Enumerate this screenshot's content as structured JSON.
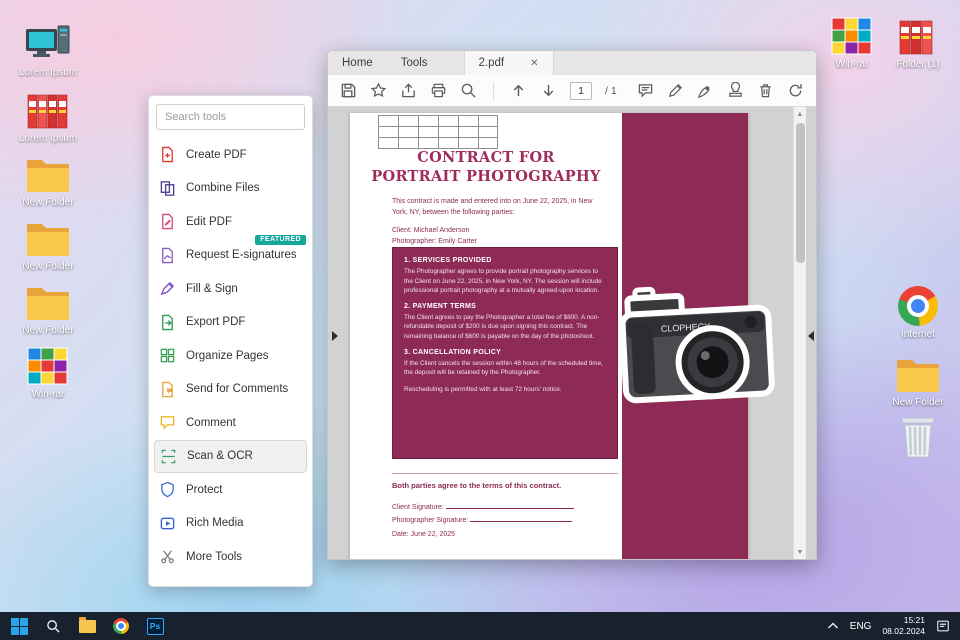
{
  "desktop": {
    "icons_left": [
      {
        "label": "Lorem Ipsum"
      },
      {
        "label": "Lorem Ipsum"
      },
      {
        "label": "New Folder"
      },
      {
        "label": "New Folder"
      },
      {
        "label": "New Folder"
      },
      {
        "label": "Win-rar"
      }
    ],
    "icons_right": [
      {
        "label": "Win-rar"
      },
      {
        "label": "Folder (1)"
      },
      {
        "label": "Internet"
      },
      {
        "label": "New Folder"
      },
      {
        "label": ""
      }
    ]
  },
  "taskbar": {
    "language": "ENG",
    "time": "15:21",
    "date": "08.02.2024",
    "photoshop_label": "Ps"
  },
  "window": {
    "tabs": [
      {
        "label": "Home"
      },
      {
        "label": "Tools"
      },
      {
        "label": "2.pdf"
      }
    ],
    "active_tab_close": "✕",
    "toolbar": {
      "page_current": "1",
      "page_total": "/ 1"
    }
  },
  "tools_panel": {
    "search_placeholder": "Search tools",
    "items": [
      {
        "label": "Create PDF"
      },
      {
        "label": "Combine Files"
      },
      {
        "label": "Edit PDF"
      },
      {
        "label": "Request E-signatures",
        "badge": "FEATURED"
      },
      {
        "label": "Fill & Sign"
      },
      {
        "label": "Export PDF"
      },
      {
        "label": "Organize Pages"
      },
      {
        "label": "Send for Comments"
      },
      {
        "label": "Comment"
      },
      {
        "label": "Scan & OCR"
      },
      {
        "label": "Protect"
      },
      {
        "label": "Rich Media"
      },
      {
        "label": "More Tools"
      }
    ]
  },
  "document": {
    "title_line1": "CONTRACT FOR",
    "title_line2": "PORTRAIT PHOTOGRAPHY",
    "intro": "This contract is made and entered into on June 22, 2025, in New York, NY, between the following parties:",
    "client_line": "Client: Michael Anderson",
    "photographer_line": "Photographer: Emily Carter",
    "sections": [
      {
        "heading": "1. SERVICES PROVIDED",
        "body": "The Photographer agrees to provide portrait photography services to the Client on June 22, 2025, in New York, NY. The session will include professional portrait photography at a mutually agreed-upon location."
      },
      {
        "heading": "2. PAYMENT TERMS",
        "body": "The Client agrees to pay the Photographer a total fee of $800. A non-refundable deposit of $200 is due upon signing this contract. The remaining balance of $600 is payable on the day of the photoshoot."
      },
      {
        "heading": "3. CANCELLATION POLICY",
        "body": "If the Client cancels the session within 48 hours of the scheduled time, the deposit will be retained by the Photographer."
      }
    ],
    "reschedule_note": "Rescheduling is permitted with at least 72 hours' notice.",
    "agreement": "Both parties agree to the terms of this contract.",
    "signature_client_label": "Client Signature:",
    "signature_photographer_label": "Photographer Signature:",
    "date_line": "Date: June 22, 2025",
    "camera_text": "CLOPHECY"
  },
  "colors": {
    "accent_maroon": "#8d2a56",
    "featured_badge": "#14a79d"
  }
}
